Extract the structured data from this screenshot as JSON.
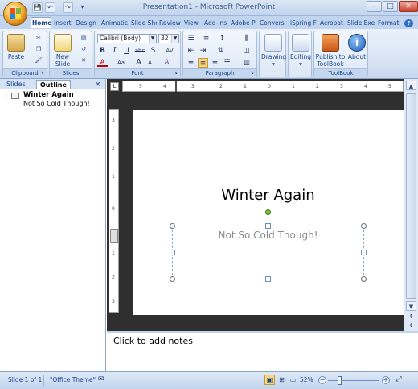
{
  "window": {
    "title": "Presentation1 - Microsoft PowerPoint",
    "minimize": "–",
    "maximize": "□",
    "close": "✕"
  },
  "qat": [
    "💾",
    "↶",
    "↷",
    "▾"
  ],
  "tabs": [
    "Home",
    "Insert",
    "Design",
    "Animatic",
    "Slide Sho",
    "Review",
    "View",
    "Add-Ins",
    "Adobe P",
    "Conversi",
    "iSpring F",
    "Acrobat",
    "Slide Exe",
    "Format"
  ],
  "ribbon": {
    "clipboard": {
      "label": "Clipboard",
      "paste": "Paste"
    },
    "slides": {
      "label": "Slides",
      "new_slide_1": "New",
      "new_slide_2": "Slide"
    },
    "font": {
      "label": "Font",
      "font_name": "Calibri (Body)",
      "font_size": "32",
      "bold": "B",
      "italic": "I",
      "underline": "U",
      "strike": "abc",
      "shadow": "S",
      "spacing": "AV",
      "grow": "A",
      "shrink": "A",
      "case": "Aa",
      "clear": "A"
    },
    "paragraph": {
      "label": "Paragraph"
    },
    "drawing": {
      "label": "Drawing"
    },
    "editing": {
      "label": "Editing"
    },
    "toolbook": {
      "label": "ToolBook",
      "publish_1": "Publish to",
      "publish_2": "ToolBook",
      "about": "About"
    }
  },
  "left_pane": {
    "tab_slides": "Slides",
    "tab_outline": "Outline",
    "close": "×",
    "slide_number": "1",
    "outline_title": "Winter Again",
    "outline_subtitle": "Not So Cold Though!"
  },
  "slide": {
    "title": "Winter Again",
    "subtitle": "Not So Cold Though!"
  },
  "notes": {
    "placeholder": "Click to add notes"
  },
  "ruler": {
    "h_ticks": [
      "5",
      "4",
      "3",
      "2",
      "1",
      "0",
      "1",
      "2",
      "3",
      "4",
      "5"
    ],
    "v_ticks": [
      "3",
      "2",
      "1",
      "0",
      "1",
      "2",
      "3"
    ]
  },
  "status": {
    "slide_info": "Slide 1 of 1",
    "theme": "\"Office Theme\"",
    "zoom": "52%"
  },
  "colors": {
    "ribbon": "#c2d5ee",
    "accent": "#15428b",
    "workspace": "#2f2f2f"
  }
}
